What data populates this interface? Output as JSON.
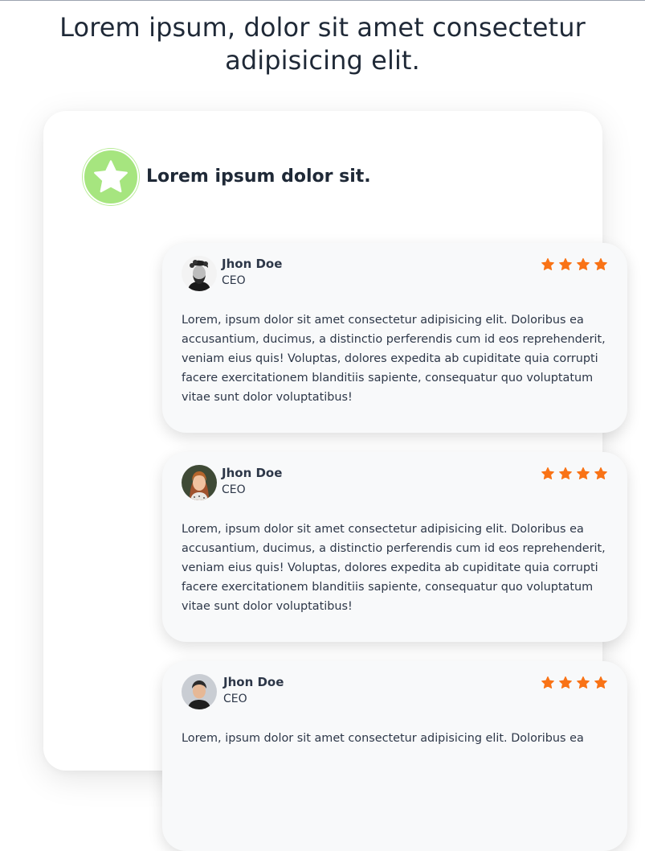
{
  "page": {
    "title": "Lorem ipsum, dolor sit amet consectetur adipisicing elit."
  },
  "card": {
    "header_title": "Lorem ipsum dolor sit.",
    "badge_icon": "star-icon",
    "badge_color": "#a6e57f"
  },
  "colors": {
    "star": "#f97316",
    "card_bg": "#f8f9fa"
  },
  "testimonials": [
    {
      "name": "Jhon Doe",
      "role": "CEO",
      "rating": 4,
      "avatar": "avatar-man-beard",
      "text": "Lorem, ipsum dolor sit amet consectetur adipisicing elit. Doloribus ea accusantium, ducimus, a distinctio perferendis cum id eos reprehenderit, veniam eius quis! Voluptas, dolores expedita ab cupiditate quia corrupti facere exercitationem blanditiis sapiente, consequatur quo voluptatum vitae sunt dolor voluptatibus!"
    },
    {
      "name": "Jhon Doe",
      "role": "CEO",
      "rating": 4,
      "avatar": "avatar-woman",
      "text": "Lorem, ipsum dolor sit amet consectetur adipisicing elit. Doloribus ea accusantium, ducimus, a distinctio perferendis cum id eos reprehenderit, veniam eius quis! Voluptas, dolores expedita ab cupiditate quia corrupti facere exercitationem blanditiis sapiente, consequatur quo voluptatum vitae sunt dolor voluptatibus!"
    },
    {
      "name": "Jhon Doe",
      "role": "CEO",
      "rating": 4,
      "avatar": "avatar-man",
      "text": "Lorem, ipsum dolor sit amet consectetur adipisicing elit. Doloribus ea"
    }
  ]
}
